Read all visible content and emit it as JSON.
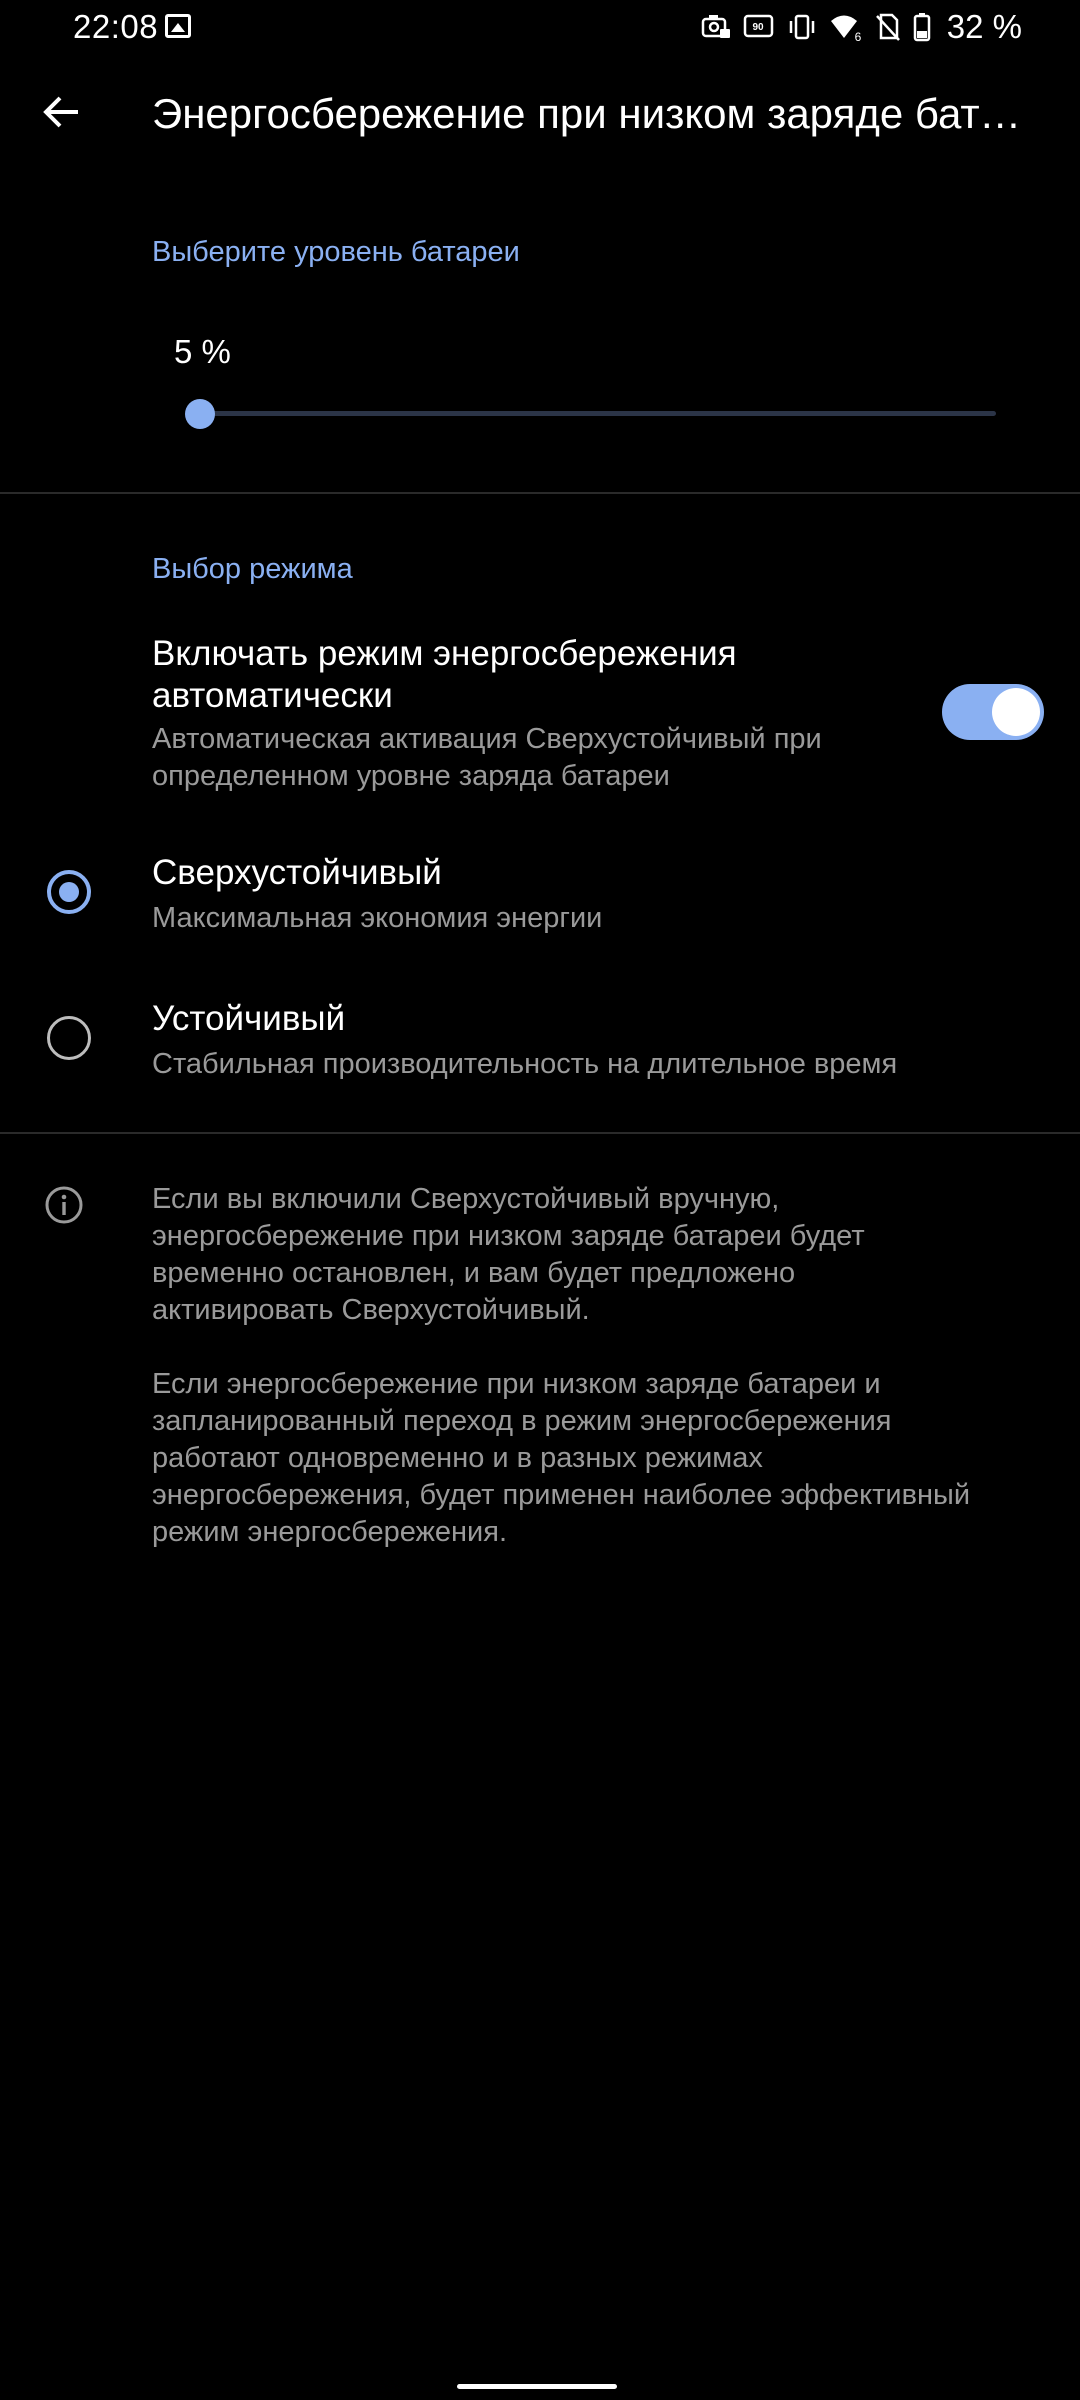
{
  "status_bar": {
    "time": "22:08",
    "battery_percent": "32 %",
    "icons": [
      "gallery-icon",
      "camera-lock-icon",
      "refresh-rate-90hz-icon",
      "vibrate-icon",
      "wifi-6-icon",
      "no-sim-icon",
      "battery-icon"
    ]
  },
  "app_bar": {
    "title": "Энергосбережение при низком заряде батареи"
  },
  "battery_level": {
    "header": "Выберите уровень батареи",
    "value_label": "5 %",
    "value": 5,
    "min": 5,
    "max": 100
  },
  "mode": {
    "header": "Выбор режима",
    "auto_toggle": {
      "title_line1": "Включать режим энергосбережения",
      "title_line2": "автоматически",
      "subtitle_line1": "Автоматическая активация Сверхустойчивый при",
      "subtitle_line2": "определенном уровне заряда батареи",
      "enabled": true
    },
    "options": [
      {
        "title": "Сверхустойчивый",
        "subtitle": "Максимальная экономия энергии",
        "selected": true
      },
      {
        "title": "Устойчивый",
        "subtitle": "Стабильная производительность на длительное время",
        "selected": false
      }
    ]
  },
  "info": {
    "paragraph1": [
      "Если вы включили Сверхустойчивый вручную,",
      "энергосбережение при низком заряде батареи будет",
      "временно остановлен, и вам будет предложено",
      "активировать Сверхустойчивый."
    ],
    "paragraph2": [
      "Если энергосбережение при низком заряде батареи и",
      "запланированный переход в режим энергосбережения",
      "работают одновременно и в разных режимах",
      "энергосбережения, будет применен наиболее эффективный",
      "режим энергосбережения."
    ]
  },
  "colors": {
    "accent": "#8ab0f2",
    "background": "#000000",
    "secondary_text": "#9a9a9a"
  }
}
